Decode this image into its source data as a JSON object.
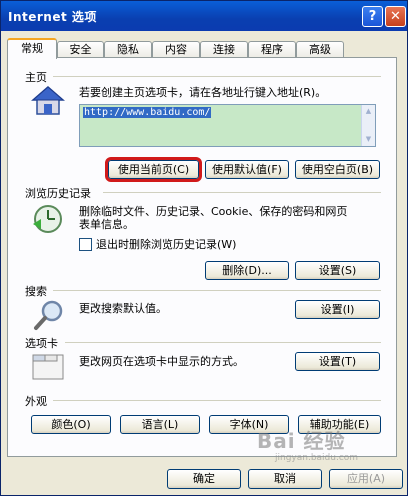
{
  "window": {
    "title": "Internet 选项",
    "help_button": "?",
    "close_button": "✕"
  },
  "tabs": [
    {
      "label": "常规",
      "active": true
    },
    {
      "label": "安全"
    },
    {
      "label": "隐私"
    },
    {
      "label": "内容"
    },
    {
      "label": "连接"
    },
    {
      "label": "程序"
    },
    {
      "label": "高级"
    }
  ],
  "homepage": {
    "section_label": "主页",
    "description": "若要创建主页选项卡，请在各地址行键入地址(R)。",
    "url": "http://www.baidu.com/",
    "use_current": "使用当前页(C)",
    "use_default": "使用默认值(F)",
    "use_blank": "使用空白页(B)"
  },
  "history": {
    "section_label": "浏览历史记录",
    "description_line1": "删除临时文件、历史记录、Cookie、保存的密码和网页",
    "description_line2": "表单信息。",
    "checkbox_label": "退出时删除浏览历史记录(W)",
    "delete_button": "删除(D)...",
    "settings_button": "设置(S)"
  },
  "search": {
    "section_label": "搜索",
    "description": "更改搜索默认值。",
    "settings_button": "设置(I)"
  },
  "tabs_section": {
    "section_label": "选项卡",
    "description": "更改网页在选项卡中显示的方式。",
    "settings_button": "设置(T)"
  },
  "appearance": {
    "section_label": "外观",
    "colors": "颜色(O)",
    "languages": "语言(L)",
    "fonts": "字体(N)",
    "accessibility": "辅助功能(E)"
  },
  "footer": {
    "ok": "确定",
    "cancel": "取消",
    "apply": "应用(A)"
  },
  "watermark": {
    "brand": "Bai 经验",
    "url": "jingyan.baidu.com"
  },
  "colors": {
    "titlebar": "#0a4fc8",
    "highlight_box": "#d11a1a",
    "url_selection": "#316ac5"
  }
}
